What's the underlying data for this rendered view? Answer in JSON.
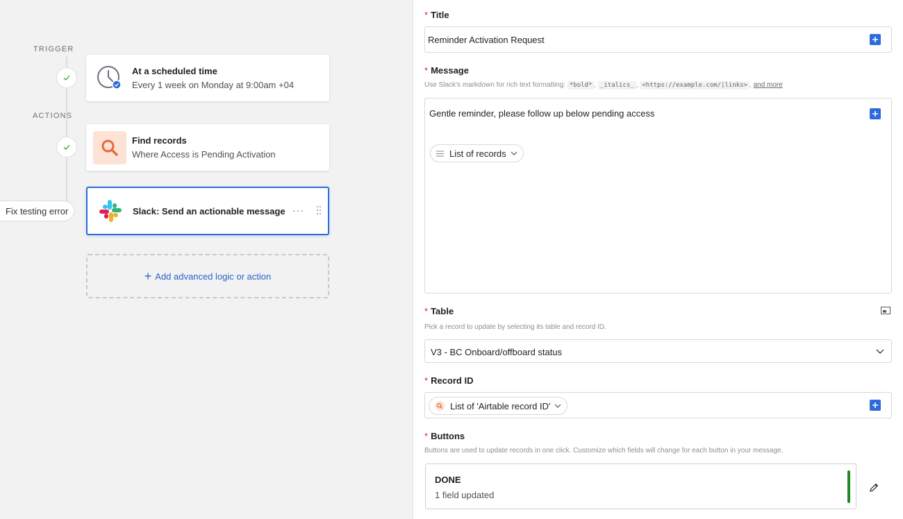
{
  "canvas": {
    "trigger_label": "TRIGGER",
    "actions_label": "ACTIONS",
    "trigger_card": {
      "title": "At a scheduled time",
      "subtitle": "Every 1 week on Monday at 9:00am +04"
    },
    "find_card": {
      "title": "Find records",
      "subtitle": "Where Access is Pending Activation"
    },
    "slack_card": {
      "title": "Slack: Send an actionable message",
      "more": "···"
    },
    "fix_error_label": "Fix testing error",
    "add_action": {
      "plus": "+",
      "label": "Add advanced logic or action"
    }
  },
  "panel": {
    "required_mark": "*",
    "title": {
      "label": "Title",
      "value": "Reminder Activation Request"
    },
    "message": {
      "label": "Message",
      "hint_prefix": "Use Slack's markdown for rich text formatting:",
      "hint_bold": "*bold*",
      "hint_italics": "_italics_",
      "hint_links": "<https://example.com/|links>",
      "hint_more": "and more",
      "value": "Gentle reminder, please follow up below pending access",
      "token": "List of records"
    },
    "table": {
      "label": "Table",
      "hint": "Pick a record to update by selecting its table and record ID.",
      "value": "V3 - BC Onboard/offboard status"
    },
    "record_id": {
      "label": "Record ID",
      "token": "List of 'Airtable record ID'"
    },
    "buttons": {
      "label": "Buttons",
      "hint": "Buttons are used to update records in one click. Customize which fields will change for each button in your message.",
      "items": [
        {
          "name": "DONE",
          "detail": "1 field updated"
        }
      ]
    }
  },
  "colors": {
    "accent": "#2d6bdc",
    "link": "#2d62c8",
    "required": "#e02525",
    "success": "#1f8a1f",
    "search_bg": "#fde3d6",
    "search_fg": "#e8693d"
  }
}
